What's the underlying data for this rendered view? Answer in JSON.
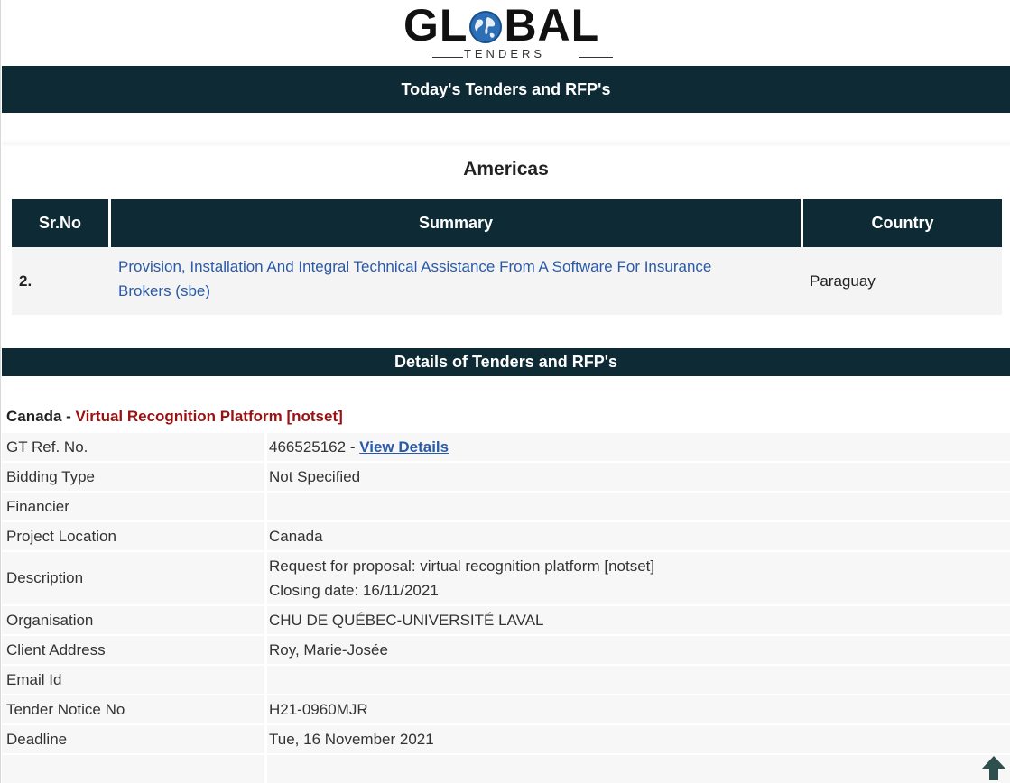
{
  "logo": {
    "text_left": "GL",
    "text_right": "BAL",
    "subtitle": "TENDERS"
  },
  "header": {
    "title": "Today's Tenders and RFP's"
  },
  "region": {
    "title": "Americas"
  },
  "summary_table": {
    "columns": [
      "Sr.No",
      "Summary",
      "Country"
    ],
    "rows": [
      {
        "no": "2.",
        "summary_line1": "Provision, Installation And Integral Technical Assistance From A Software For Insurance",
        "summary_line2": "Brokers (sbe)",
        "country": "Paraguay"
      }
    ]
  },
  "details": {
    "section_title": "Details of Tenders and RFP's",
    "country": "Canada",
    "separator": " - ",
    "project": "Virtual Recognition Platform [notset]",
    "fields": {
      "gt_ref": {
        "label": "GT Ref. No.",
        "value": "466525162",
        "link_sep": " - ",
        "link": "View Details"
      },
      "bidding_type": {
        "label": "Bidding Type",
        "value": "Not Specified"
      },
      "financier": {
        "label": "Financier",
        "value": ""
      },
      "project_location": {
        "label": "Project Location",
        "value": "Canada"
      },
      "description": {
        "label": "Description",
        "value_line1": "Request for proposal: virtual recognition platform [notset]",
        "value_line2": "Closing date: 16/11/2021"
      },
      "organisation": {
        "label": "Organisation",
        "value": "CHU DE QUÉBEC-UNIVERSITÉ LAVAL"
      },
      "client_address": {
        "label": "Client Address",
        "value": "Roy, Marie-Josée"
      },
      "email": {
        "label": "Email Id",
        "value": ""
      },
      "tender_notice": {
        "label": "Tender Notice No",
        "value": "H21-0960MJR"
      },
      "deadline": {
        "label": "Deadline",
        "value": "Tue, 16 November 2021"
      }
    }
  },
  "icons": {
    "globe": "globe-icon",
    "scroll_top": "arrow-up-icon"
  },
  "colors": {
    "header_bg": "#0e2a35",
    "link": "#2a5aa8",
    "project_title": "#9a1111"
  }
}
